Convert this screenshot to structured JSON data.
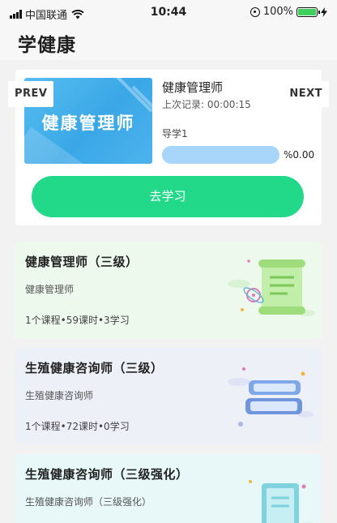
{
  "status_bar": {
    "carrier": "中国联通",
    "time": "10:44",
    "battery": "100%",
    "battery_level": 1.0,
    "icons": [
      "signal-icon",
      "wifi-icon",
      "orientation-lock-icon",
      "battery-icon",
      "charging-icon"
    ]
  },
  "header": {
    "title": "学健康"
  },
  "current_course": {
    "cover_text": "健康管理师",
    "title": "健康管理师",
    "last_record": "上次记录: 00:00:15",
    "guide": "导学1",
    "progress_label": "%0.00",
    "progress_value": 0.0,
    "action": "去学习",
    "prev": "PREV",
    "next": "NEXT"
  },
  "courses": [
    {
      "title": "健康管理师（三级）",
      "subtitle": "健康管理师",
      "meta": "1个课程•59课时•3学习",
      "bg": "#eef9ee",
      "illustration": "scroll-atom-icon"
    },
    {
      "title": "生殖健康咨询师（三级）",
      "subtitle": "生殖健康咨询师",
      "meta": "1个课程•72课时•0学习",
      "bg": "#eef0f8",
      "illustration": "books-stack-icon"
    },
    {
      "title": "生殖健康咨询师（三级强化）",
      "subtitle": "生殖健康咨询师（三级强化）",
      "meta": "",
      "bg": "#e8f8f8",
      "illustration": "notebook-icon"
    }
  ],
  "colors": {
    "accent_green": "#22d98a",
    "cover_blue": "#3aa7e6",
    "progress_blue": "#a8d6fb"
  }
}
